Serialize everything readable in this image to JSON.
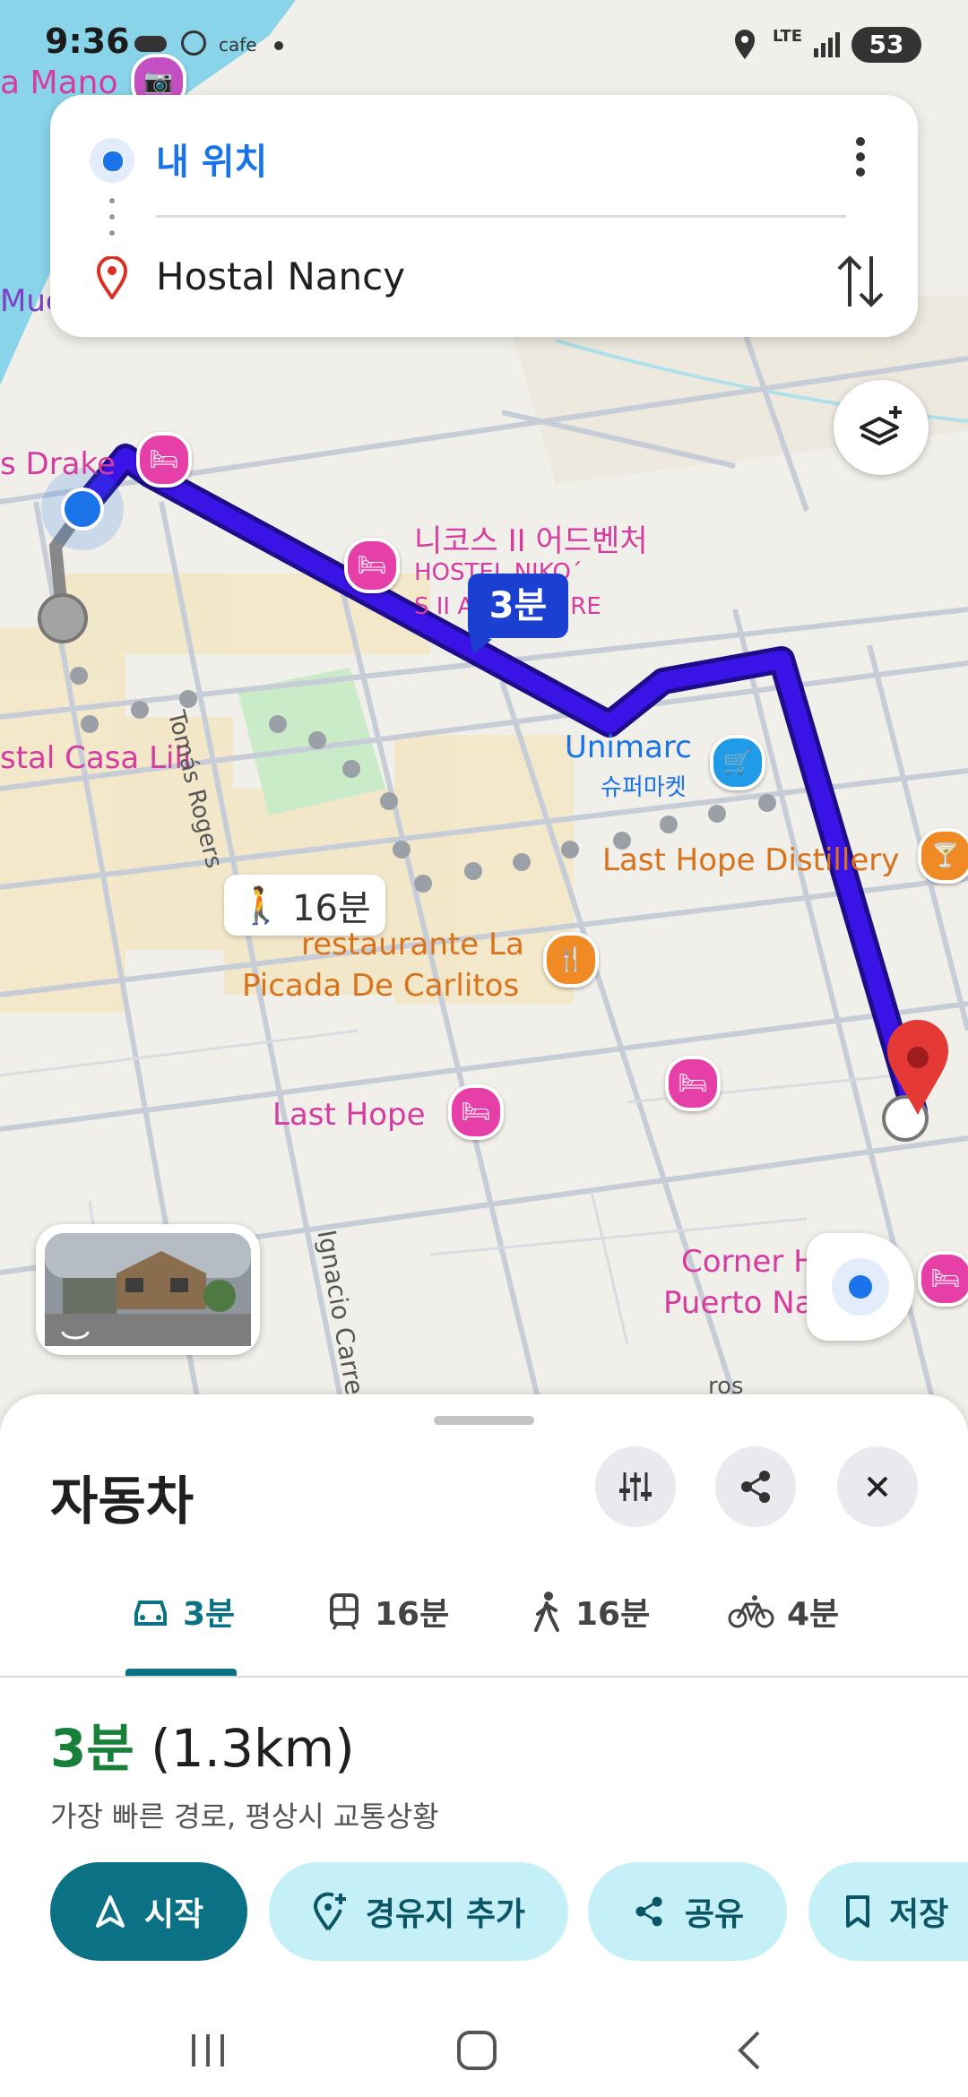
{
  "status_bar": {
    "time": "9:36",
    "carrier_label": "cafe",
    "network": "LTE",
    "battery": "53"
  },
  "search_card": {
    "origin": "내 위치",
    "destination": "Hostal Nancy"
  },
  "map": {
    "route_duration_bubble": "3분",
    "walk_chip": "16분",
    "labels": {
      "mano": "a Mano",
      "mue": "Mue",
      "drake": "s Drake",
      "nikos_ko": "니코스 II 어드벤처",
      "nikos_en_1": "HOSTEL NIKO´",
      "nikos_en_2": "S II ADVENTURE",
      "unimarc": "Unimarc",
      "unimarc_sub": "슈퍼마켓",
      "casa_lili": "stal Casa Lili",
      "last_hope_distillery": "Last Hope Distillery",
      "restaurante_1": "restaurante La",
      "restaurante_2": "Picada De Carlitos",
      "last_hope": "Last Hope",
      "corner_1": "Corner H",
      "corner_2": "Puerto Na",
      "street_rogers": "Tomás Rogers",
      "street_carrera": "Ignacio Carrera",
      "street_ros": "ros"
    }
  },
  "sheet": {
    "title": "자동차",
    "modes": [
      {
        "icon": "car-icon",
        "label": "3분"
      },
      {
        "icon": "transit-icon",
        "label": "16분"
      },
      {
        "icon": "walk-icon",
        "label": "16분"
      },
      {
        "icon": "bike-icon",
        "label": "4분"
      }
    ],
    "route_time": "3분",
    "route_distance": "(1.3km)",
    "route_desc": "가장 빠른 경로, 평상시 교통상황",
    "actions": {
      "start": "시작",
      "add_stop": "경유지 추가",
      "share": "공유",
      "save": "저장"
    }
  },
  "colors": {
    "route": "#3a14e6",
    "accent_teal": "#0b7285",
    "light_teal": "#c6f0f8",
    "hotel_pink": "#e63fa8",
    "food_orange": "#f08a24"
  }
}
